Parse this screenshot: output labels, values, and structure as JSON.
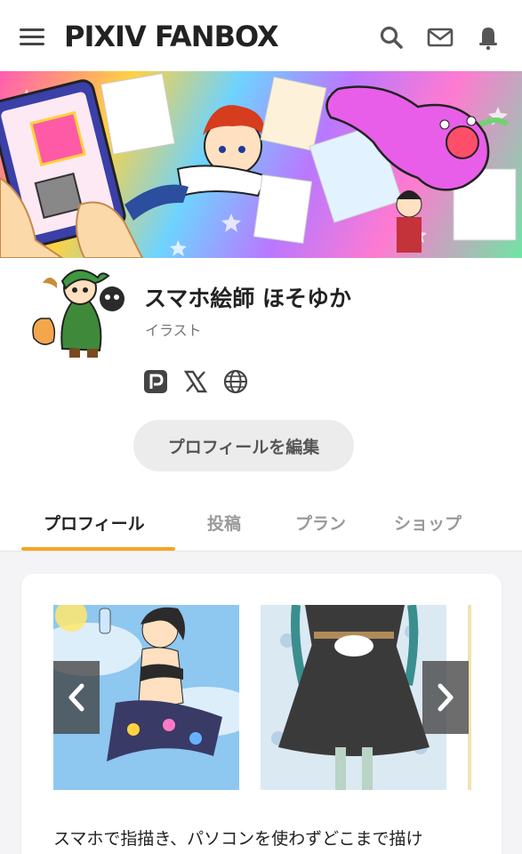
{
  "header": {
    "logo": "PIXIV FANBOX",
    "icons": [
      "menu-icon",
      "search-icon",
      "mail-icon",
      "bell-icon"
    ]
  },
  "creator": {
    "name": "スマホ絵師 ほそゆか",
    "category": "イラスト",
    "social_icons": [
      "pixiv-icon",
      "x-icon",
      "globe-icon"
    ],
    "edit_label": "プロフィールを編集"
  },
  "tabs": [
    {
      "label": "プロフィール",
      "active": true
    },
    {
      "label": "投稿",
      "active": false
    },
    {
      "label": "プラン",
      "active": false
    },
    {
      "label": "ショップ",
      "active": false
    }
  ],
  "profile": {
    "description": "スマホで指描き、パソコンを使わずどこまで描け"
  },
  "colors": {
    "accent": "#f5a623",
    "text": "#222222",
    "muted": "#9a9a9a"
  }
}
